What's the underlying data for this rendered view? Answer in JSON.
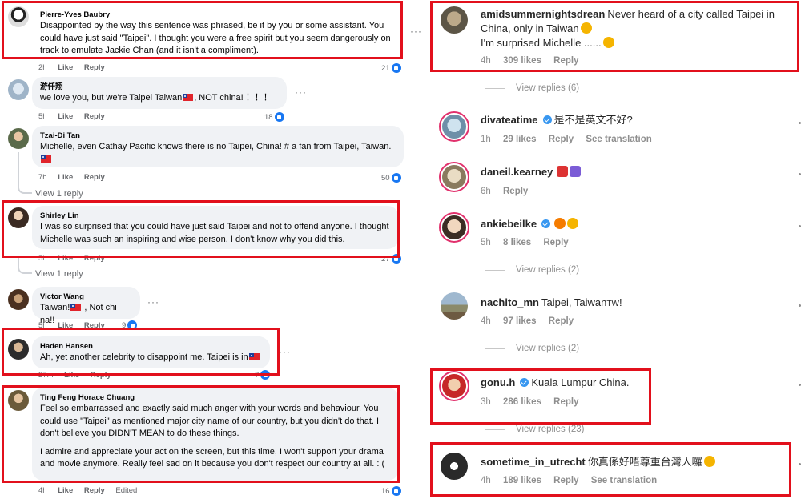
{
  "facebook": {
    "comments": [
      {
        "name": "Pierre-Yves Baubry",
        "text": "Disappointed by the way this sentence was phrased, be it by you or some assistant. You could have just said \"Taipei\". I thought you were a free spirit but you seem dangerously on track to emulate Jackie Chan (and it isn't a compliment).",
        "time": "2h",
        "like": "Like",
        "reply": "Reply",
        "count": "21",
        "dots": "···"
      },
      {
        "name": "游仟翔",
        "text_a": "we love you, but we're Taipei Taiwan",
        "text_b": ", NOT china! ！！！",
        "time": "5h",
        "like": "Like",
        "reply": "Reply",
        "count": "18",
        "dots": "···"
      },
      {
        "name": "Tzai-Di Tan",
        "text": "Michelle, even Cathay Pacific knows there is no Taipei, China! # a fan from Taipei, Taiwan.",
        "time": "7h",
        "like": "Like",
        "reply": "Reply",
        "count": "50",
        "view_replies": "View 1 reply"
      },
      {
        "name": "Shirley Lin",
        "text": "I was so surprised that you could have just said Taipei and not to offend anyone. I thought Michelle was such an inspiring and wise person. I don't know why you did this.",
        "time": "5h",
        "like": "Like",
        "reply": "Reply",
        "count": "27",
        "view_replies": "View 1 reply"
      },
      {
        "name": "Victor Wang",
        "text_a": "Taiwan!",
        "text_b": " , Not chi na!!",
        "time": "5h",
        "like": "Like",
        "reply": "Reply",
        "count": "9",
        "dots": "···"
      },
      {
        "name": "Haden Hansen",
        "text": "Ah, yet another celebrity to disappoint me. Taipei is in",
        "time": "27m",
        "like": "Like",
        "reply": "Reply",
        "count": "7",
        "dots": "···"
      },
      {
        "name": "Ting Feng Horace Chuang",
        "p1": "Feel so embarrassed and exactly said much anger with your words and behaviour. You could use \"Taipei\" as mentioned major city name of our country, but you didn't do that. I don't believe you DIDN'T MEAN to do these things.",
        "p2": "I admire and appreciate your act on the screen, but this time, I won't support your drama and movie anymore. Really feel sad on it because you don't respect our country at all. : (",
        "time": "4h",
        "like": "Like",
        "reply": "Reply",
        "edited": "Edited",
        "count": "16"
      }
    ]
  },
  "instagram": {
    "comments": [
      {
        "user": "amidsummernightsdrean",
        "text": "Never heard of a city called Taipei in China, only in Taiwan",
        "text2": "I'm surprised Michelle ......",
        "time": "4h",
        "likes": "309 likes",
        "reply": "Reply",
        "view_replies": "View replies (6)"
      },
      {
        "user": "divateatime",
        "text": "是不是英文不好?",
        "time": "1h",
        "likes": "29 likes",
        "reply": "Reply",
        "translation": "See translation"
      },
      {
        "user": "daneil.kearney",
        "text": "",
        "time": "6h",
        "reply": "Reply"
      },
      {
        "user": "ankiebeilke",
        "text": "",
        "time": "5h",
        "likes": "8 likes",
        "reply": "Reply",
        "view_replies": "View replies (2)"
      },
      {
        "user": "nachito_mn",
        "text": "Taipei, Taiwan",
        "flag_text": "TW",
        "text_end": "!",
        "time": "4h",
        "likes": "97 likes",
        "reply": "Reply",
        "view_replies": "View replies (2)"
      },
      {
        "user": "gonu.h",
        "text": "Kuala Lumpur China.",
        "time": "3h",
        "likes": "286 likes",
        "reply": "Reply",
        "view_replies": "View replies (23)"
      },
      {
        "user": "sometime_in_utrecht",
        "text": "你真係好唔尊重台灣人囉",
        "time": "4h",
        "likes": "189 likes",
        "reply": "Reply",
        "translation": "See translation"
      }
    ]
  },
  "colors": {
    "highlight": "#e2101c",
    "facebook_blue": "#1877f2",
    "bubble": "#f0f2f5",
    "instagram_verified": "#3897f0",
    "muted": "#8e8e8e"
  },
  "icons": [
    "like-reaction-icon",
    "more-options-icon",
    "taiwan-flag-icon",
    "verified-badge-icon",
    "emoji-icon"
  ]
}
